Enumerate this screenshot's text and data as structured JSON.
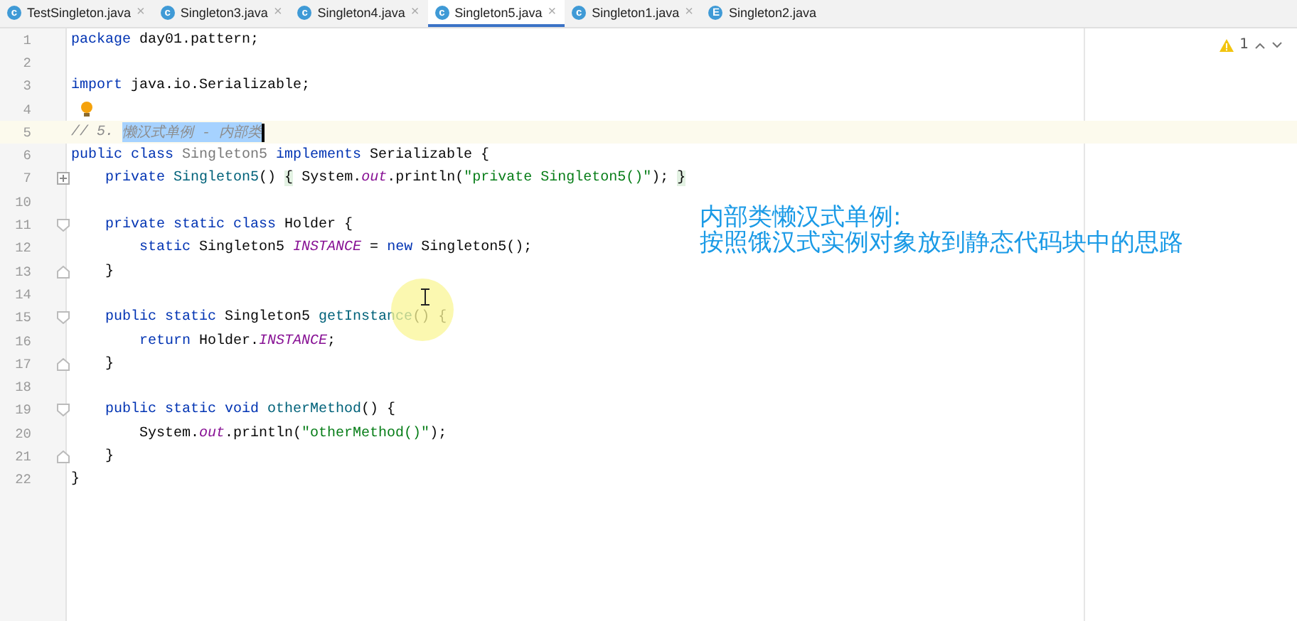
{
  "tabs": [
    {
      "label": "TestSingleton.java",
      "icon_letter": "c",
      "selected": false,
      "close": "×"
    },
    {
      "label": "Singleton3.java",
      "icon_letter": "c",
      "selected": false,
      "close": "×"
    },
    {
      "label": "Singleton4.java",
      "icon_letter": "c",
      "selected": false,
      "close": "×"
    },
    {
      "label": "Singleton5.java",
      "icon_letter": "c",
      "selected": true,
      "close": "×"
    },
    {
      "label": "Singleton1.java",
      "icon_letter": "c",
      "selected": false,
      "close": "×"
    },
    {
      "label": "Singleton2.java",
      "icon_letter": "E",
      "selected": false
    }
  ],
  "inspections": {
    "warnings": "1"
  },
  "lines": [
    {
      "number": "1",
      "kind": "plain",
      "current": false,
      "tokens": [
        {
          "text": "package",
          "kind": "keyword"
        },
        {
          "text": " day01.pattern;",
          "kind": "plain"
        }
      ]
    },
    {
      "number": "2",
      "kind": "plain",
      "current": false
    },
    {
      "number": "3",
      "kind": "plain",
      "current": false,
      "tokens": [
        {
          "text": "import",
          "kind": "keyword"
        },
        {
          "text": " java.io.Serializable;",
          "kind": "plain"
        }
      ]
    },
    {
      "number": "4",
      "kind": "bulb",
      "current": false
    },
    {
      "number": "5",
      "kind": "plain",
      "current": true,
      "tokens": [
        {
          "text": "// 5. ",
          "kind": "comment"
        },
        {
          "text": "懒汉式单例 - 内部类",
          "kind": "selected-comment"
        }
      ]
    },
    {
      "number": "6",
      "kind": "plain",
      "current": false,
      "tokens": [
        {
          "text": "public class",
          "kind": "keyword"
        },
        {
          "text": " Singleton5 ",
          "kind": "unused"
        },
        {
          "text": "implements",
          "kind": "keyword"
        },
        {
          "text": " Serializable {",
          "kind": "plain"
        }
      ]
    },
    {
      "number": "7",
      "kind": "folded",
      "current": false,
      "tokens": [
        {
          "text": "    private",
          "kind": "keyword"
        },
        {
          "text": " Singleton5",
          "kind": "method"
        },
        {
          "text": "() ",
          "kind": "plain"
        },
        {
          "text": "{",
          "kind": "folded"
        },
        {
          "text": " System.",
          "kind": "plain"
        },
        {
          "text": "out",
          "kind": "field"
        },
        {
          "text": ".println(",
          "kind": "plain"
        },
        {
          "text": "\"private Singleton5()\"",
          "kind": "string"
        },
        {
          "text": "); ",
          "kind": "plain"
        },
        {
          "text": "}",
          "kind": "folded"
        }
      ]
    },
    {
      "number": "10",
      "kind": "plain",
      "current": false
    },
    {
      "number": "11",
      "kind": "fold-start",
      "current": false,
      "tokens": [
        {
          "text": "    private static class",
          "kind": "keyword"
        },
        {
          "text": " Holder {",
          "kind": "plain"
        }
      ]
    },
    {
      "number": "12",
      "kind": "plain",
      "current": false,
      "tokens": [
        {
          "text": "        static",
          "kind": "keyword"
        },
        {
          "text": " Singleton5 ",
          "kind": "plain"
        },
        {
          "text": "INSTANCE",
          "kind": "field"
        },
        {
          "text": " = ",
          "kind": "plain"
        },
        {
          "text": "new",
          "kind": "keyword"
        },
        {
          "text": " Singleton5();",
          "kind": "plain"
        }
      ]
    },
    {
      "number": "13",
      "kind": "fold-end",
      "current": false,
      "tokens": [
        {
          "text": "    }",
          "kind": "plain"
        }
      ]
    },
    {
      "number": "14",
      "kind": "plain",
      "current": false
    },
    {
      "number": "15",
      "kind": "fold-start",
      "current": false,
      "tokens": [
        {
          "text": "    public static",
          "kind": "keyword"
        },
        {
          "text": " Singleton5 ",
          "kind": "plain"
        },
        {
          "text": "getInstance",
          "kind": "method"
        },
        {
          "text": "() {",
          "kind": "plain"
        }
      ]
    },
    {
      "number": "16",
      "kind": "plain",
      "current": false,
      "tokens": [
        {
          "text": "        return",
          "kind": "keyword"
        },
        {
          "text": " Holder.",
          "kind": "plain"
        },
        {
          "text": "INSTANCE",
          "kind": "field"
        },
        {
          "text": ";",
          "kind": "plain"
        }
      ]
    },
    {
      "number": "17",
      "kind": "fold-end",
      "current": false,
      "tokens": [
        {
          "text": "    }",
          "kind": "plain"
        }
      ]
    },
    {
      "number": "18",
      "kind": "plain",
      "current": false
    },
    {
      "number": "19",
      "kind": "fold-start",
      "current": false,
      "tokens": [
        {
          "text": "    public static void",
          "kind": "keyword"
        },
        {
          "text": " otherMethod",
          "kind": "method"
        },
        {
          "text": "() {",
          "kind": "plain"
        }
      ]
    },
    {
      "number": "20",
      "kind": "plain",
      "current": false,
      "tokens": [
        {
          "text": "        System.",
          "kind": "plain"
        },
        {
          "text": "out",
          "kind": "field"
        },
        {
          "text": ".println(",
          "kind": "plain"
        },
        {
          "text": "\"otherMethod()\"",
          "kind": "string"
        },
        {
          "text": ");",
          "kind": "plain"
        }
      ]
    },
    {
      "number": "21",
      "kind": "fold-end",
      "current": false,
      "tokens": [
        {
          "text": "    }",
          "kind": "plain"
        }
      ]
    },
    {
      "number": "22",
      "kind": "plain",
      "current": false,
      "tokens": [
        {
          "text": "}",
          "kind": "plain"
        }
      ]
    }
  ],
  "annotation": [
    "内部类懒汉式单例:",
    "按照饿汉式实例对象放到静态代码块中的思路"
  ]
}
